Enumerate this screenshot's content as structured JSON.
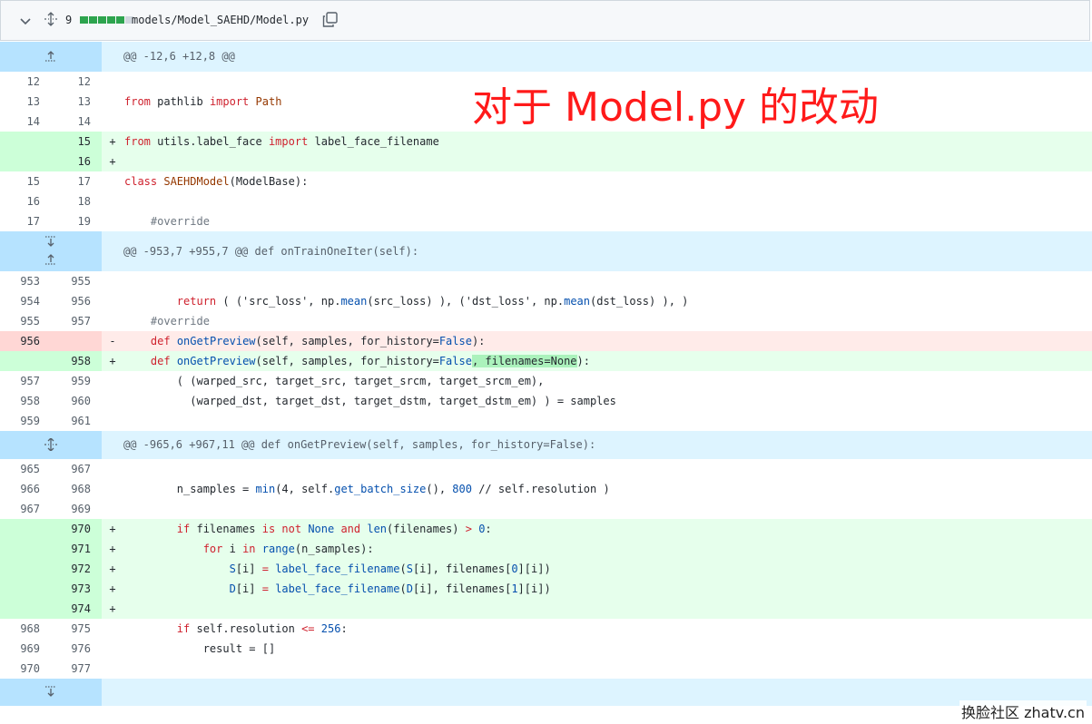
{
  "file": {
    "additions_count": "9",
    "path": "models/Model_SAEHD/Model.py",
    "bar_colors": [
      "#2da44e",
      "#2da44e",
      "#2da44e",
      "#2da44e",
      "#2da44e",
      "#d0d7de"
    ]
  },
  "annotation": "对于 Model.py 的改动",
  "watermark": "换脸社区 zhatv.cn",
  "hunks": {
    "h1": "@@ -12,6 +12,8 @@",
    "h2": "@@ -953,7 +955,7 @@ def onTrainOneIter(self):",
    "h3": "@@ -965,6 +967,11 @@ def onGetPreview(self, samples, for_history=False):"
  },
  "lines": {
    "l1": {
      "a": "12",
      "b": "12"
    },
    "l2": {
      "a": "13",
      "b": "13"
    },
    "l3": {
      "a": "14",
      "b": "14"
    },
    "l4": {
      "a": "",
      "b": "15"
    },
    "l5": {
      "a": "",
      "b": "16"
    },
    "l6": {
      "a": "15",
      "b": "17"
    },
    "l7": {
      "a": "16",
      "b": "18"
    },
    "l8": {
      "a": "17",
      "b": "19"
    },
    "l9": {
      "a": "953",
      "b": "955"
    },
    "l10": {
      "a": "954",
      "b": "956"
    },
    "l11": {
      "a": "955",
      "b": "957"
    },
    "l12": {
      "a": "956",
      "b": ""
    },
    "l13": {
      "a": "",
      "b": "958"
    },
    "l14": {
      "a": "957",
      "b": "959"
    },
    "l15": {
      "a": "958",
      "b": "960"
    },
    "l16": {
      "a": "959",
      "b": "961"
    },
    "l17": {
      "a": "965",
      "b": "967"
    },
    "l18": {
      "a": "966",
      "b": "968"
    },
    "l19": {
      "a": "967",
      "b": "969"
    },
    "l20": {
      "a": "",
      "b": "970"
    },
    "l21": {
      "a": "",
      "b": "971"
    },
    "l22": {
      "a": "",
      "b": "972"
    },
    "l23": {
      "a": "",
      "b": "973"
    },
    "l24": {
      "a": "",
      "b": "974"
    },
    "l25": {
      "a": "968",
      "b": "975"
    },
    "l26": {
      "a": "969",
      "b": "976"
    },
    "l27": {
      "a": "970",
      "b": "977"
    }
  },
  "code": {
    "l2": {
      "k1": "from",
      "t1": " pathlib ",
      "k2": "import",
      "t2": " Path"
    },
    "l4": {
      "k1": "from",
      "t1": " utils.label_face ",
      "k2": "import",
      "t2": " label_face_filename"
    },
    "l6": {
      "k1": "class",
      "c1": " SAEHDModel",
      "t1": "(ModelBase):"
    },
    "l8": {
      "t1": "    #override"
    },
    "l10": {
      "k1": "return",
      "t1": " ( ('src_loss', np.",
      "f1": "mean",
      "t2": "(src_loss) ), ('dst_loss', np.",
      "f2": "mean",
      "t3": "(dst_loss) ), )"
    },
    "l11": {
      "t1": "    #override"
    },
    "l12": {
      "k1": "def",
      "f1": " onGetPreview",
      "t1": "(self, samples, for_history=",
      "c1": "False",
      "t2": "):"
    },
    "l13": {
      "k1": "def",
      "f1": " onGetPreview",
      "t1": "(self, samples, for_history=",
      "c1": "False",
      "h1": ", filenames=None",
      "t2": "):"
    },
    "l14": {
      "t1": "        ( (warped_src, target_src, target_srcm, target_srcm_em),"
    },
    "l15": {
      "t1": "          (warped_dst, target_dst, target_dstm, target_dstm_em) ) = samples"
    },
    "l18": {
      "t1": "        n_samples = ",
      "f1": "min",
      "t2": "(4, self.",
      "f2": "get_batch_size",
      "t3": "(), ",
      "c1": "800",
      "t4": " // self.resolution )"
    },
    "l20": {
      "k1": "if",
      "t1": " filenames ",
      "k2": "is not",
      "c1": " None",
      "k3": " and",
      "f1": " len",
      "t2": "(filenames) ",
      "k4": ">",
      "c2": " 0",
      "t3": ":"
    },
    "l21": {
      "k1": "for",
      "t1": " i ",
      "k2": "in",
      "f1": " range",
      "t2": "(n_samples):"
    },
    "l22": {
      "c1": "S",
      "t1": "[i] ",
      "k1": "=",
      "f1": " label_face_filename",
      "t2": "(",
      "c2": "S",
      "t3": "[i], filenames[",
      "c3": "0",
      "t4": "][i])"
    },
    "l23": {
      "c1": "D",
      "t1": "[i] ",
      "k1": "=",
      "f1": " label_face_filename",
      "t2": "(",
      "c2": "D",
      "t3": "[i], filenames[",
      "c3": "1",
      "t4": "][i])"
    },
    "l25": {
      "k1": "if",
      "t1": " self.resolution ",
      "k2": "<=",
      "c1": " 256",
      "t2": ":"
    },
    "l26": {
      "t1": "result = []"
    }
  },
  "signs": {
    "add": "+",
    "del": "-"
  }
}
